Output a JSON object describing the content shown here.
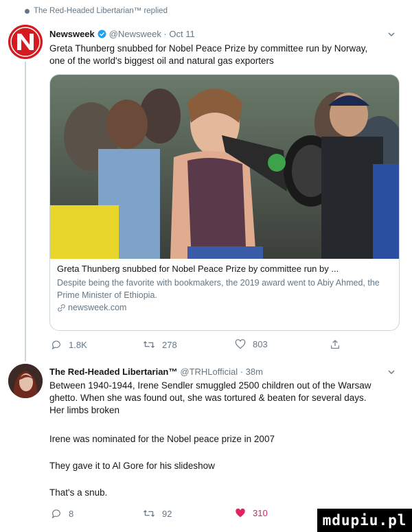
{
  "reply_banner": "The Red-Headed Libertarian™ replied",
  "tweet1": {
    "name": "Newsweek",
    "handle_time": "@Newsweek · Oct 11",
    "text": "Greta Thunberg snubbed for Nobel Peace Prize by committee run by Norway, one of the world's biggest oil and natural gas exporters",
    "card": {
      "title": "Greta Thunberg snubbed for Nobel Peace Prize by committee run by ...",
      "description": "Despite being the favorite with bookmakers, the 2019 award went to Abiy Ahmed, the Prime Minister of Ethiopia.",
      "domain": "newsweek.com"
    },
    "actions": {
      "replies": "1.8K",
      "retweets": "278",
      "likes": "803"
    }
  },
  "tweet2": {
    "name": "The Red-Headed Libertarian™",
    "handle_time": "@TRHLofficial · 38m",
    "para1": "Between 1940-1944, Irene Sendler smuggled 2500 children out of the Warsaw ghetto. When she was found out, she was tortured & beaten for several days. Her limbs broken",
    "para2": "Irene was nominated for the Nobel peace prize in 2007",
    "para3": "They gave it to Al Gore for his slideshow",
    "para4": "That's a snub.",
    "actions": {
      "replies": "8",
      "retweets": "92",
      "likes": "310"
    }
  },
  "watermark": "mdupiu.pl",
  "colors": {
    "like_active": "#e0245e",
    "newsweek_red": "#d31b21",
    "verified": "#1da1f2",
    "muted": "#657786"
  }
}
